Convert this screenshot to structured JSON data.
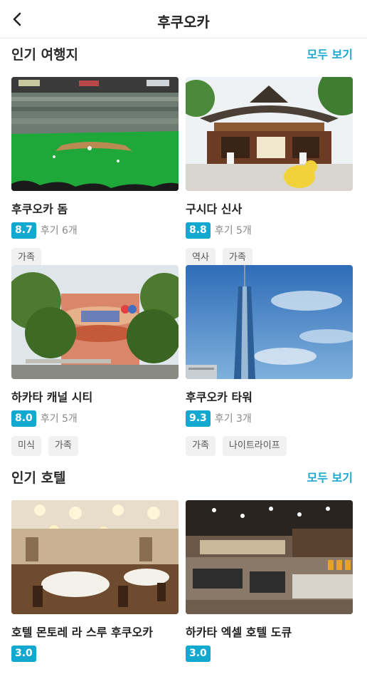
{
  "header": {
    "title": "후쿠오카",
    "back_icon": "chevron-left-icon"
  },
  "popular_places": {
    "title": "인기 여행지",
    "see_all": "모두 보기",
    "items": [
      {
        "name": "후쿠오카 돔",
        "score": "8.7",
        "reviews": "후기 6개",
        "tags": [
          "가족"
        ]
      },
      {
        "name": "구시다 신사",
        "score": "8.8",
        "reviews": "후기 5개",
        "tags": [
          "역사",
          "가족"
        ]
      },
      {
        "name": "하카타 캐널 시티",
        "score": "8.0",
        "reviews": "후기 5개",
        "tags": [
          "미식",
          "가족"
        ]
      },
      {
        "name": "후쿠오카 타워",
        "score": "9.3",
        "reviews": "후기 3개",
        "tags": [
          "가족",
          "나이트라이프"
        ]
      }
    ]
  },
  "popular_hotels": {
    "title": "인기 호텔",
    "see_all": "모두 보기",
    "items": [
      {
        "name": "호텔 몬토레 라 스루 후쿠오카",
        "score": "3.0"
      },
      {
        "name": "하카타 엑셀 호텔 도큐",
        "score": "3.0"
      }
    ]
  },
  "colors": {
    "accent": "#1aa8cf",
    "score_badge": "#12a8cf",
    "tag_bg": "#f1f1f1"
  }
}
